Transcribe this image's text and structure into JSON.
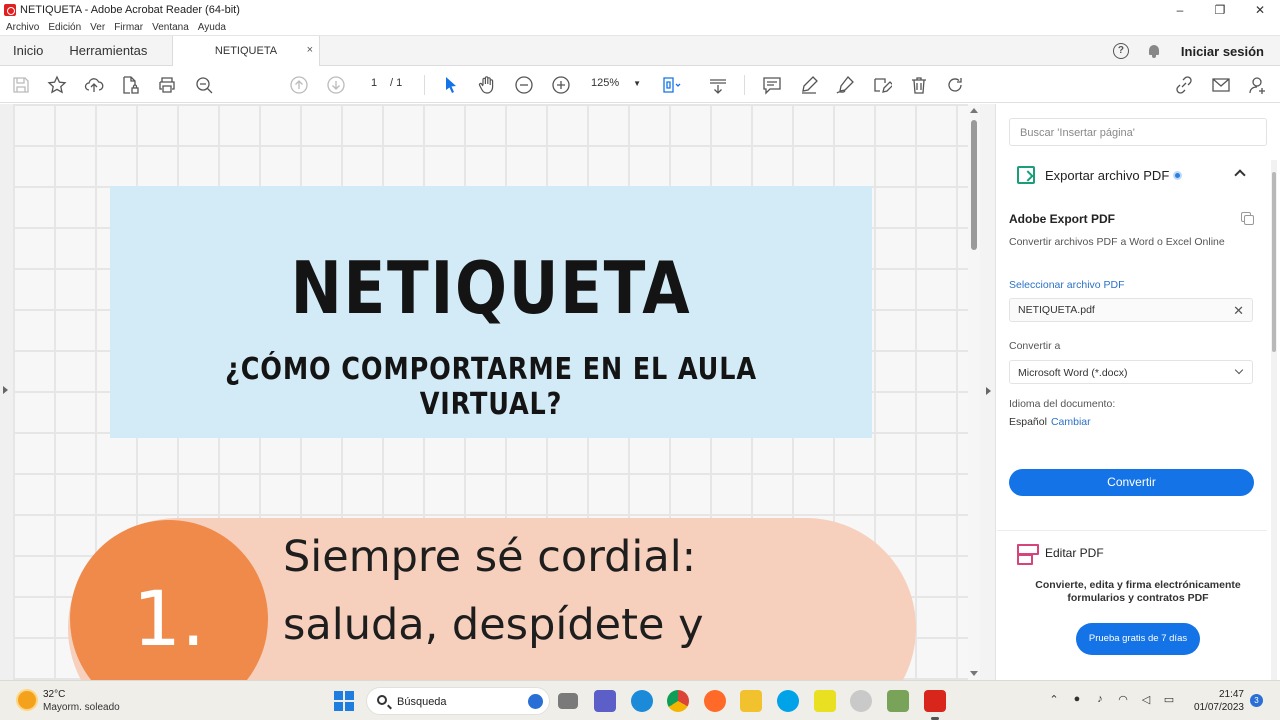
{
  "window": {
    "title": "NETIQUETA - Adobe Acrobat Reader (64-bit)",
    "controls": [
      "–",
      "❐",
      "✕"
    ]
  },
  "menu": [
    "Archivo",
    "Edición",
    "Ver",
    "Firmar",
    "Ventana",
    "Ayuda"
  ],
  "tabs": {
    "home": "Inicio",
    "tools": "Herramientas",
    "document": "NETIQUETA",
    "close": "×"
  },
  "header_right": {
    "help": "?",
    "signin": "Iniciar sesión"
  },
  "toolbar": {
    "page_current": "1",
    "page_total": "/ 1",
    "zoom": "125%",
    "icons": [
      "save-icon",
      "bookmark-star-icon",
      "upload-cloud-icon",
      "document-lock-icon",
      "print-icon",
      "zoom-search-icon",
      "prev-page-icon",
      "next-page-icon",
      "select-arrow-icon",
      "hand-icon",
      "zoom-out-icon",
      "zoom-in-icon",
      "fit-page-icon",
      "scroll-mode-icon",
      "comment-icon",
      "highlight-pen-icon",
      "sign-pen-icon",
      "fill-sign-icon",
      "delete-icon",
      "rotate-icon",
      "link-icon",
      "mail-icon",
      "share-user-icon"
    ]
  },
  "document": {
    "title": "NETIQUETA",
    "subtitle": "¿CÓMO COMPORTARME EN EL AULA VIRTUAL?",
    "rule_number": "1.",
    "rule_line1": "Siempre sé cordial:",
    "rule_line2": "saluda, despídete y",
    "colors": {
      "banner": "#d3ebf7",
      "pill": "#f6d0bc",
      "circle": "#f08a4b"
    }
  },
  "right_panel": {
    "search_placeholder": "Buscar 'Insertar página'",
    "export_title": "Exportar archivo PDF",
    "service_title": "Adobe Export PDF",
    "service_desc": "Convertir archivos PDF a Word o Excel Online",
    "select_label": "Seleccionar archivo PDF",
    "file_name": "NETIQUETA.pdf",
    "convert_to_label": "Convertir a",
    "convert_to_value": "Microsoft Word (*.docx)",
    "language_label": "Idioma del documento:",
    "language_value": "Español",
    "language_change": "Cambiar",
    "convert_button": "Convertir",
    "edit_title": "Editar PDF",
    "promo_text": "Convierte, edita y firma electrónicamente formularios y contratos PDF",
    "trial_button": "Prueba gratis de 7 días",
    "accent_color": "#1473e6"
  },
  "taskbar": {
    "temperature": "32°C",
    "weather": "Mayorm. soleado",
    "search_label": "Búsqueda",
    "time": "21:47",
    "date": "01/07/2023",
    "notification_count": "3"
  }
}
